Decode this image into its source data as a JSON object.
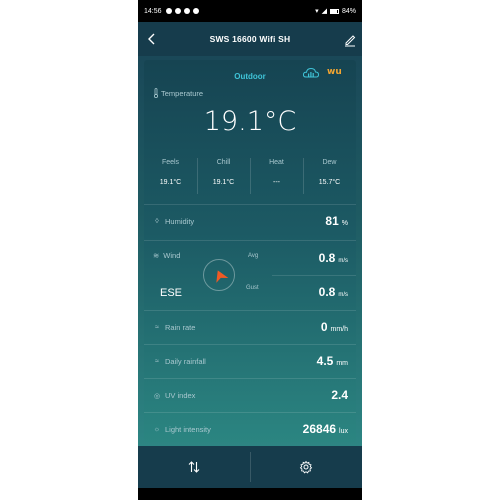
{
  "statusbar": {
    "time": "14:56",
    "battery": "84%"
  },
  "header": {
    "title": "SWS 16600 Wifi SH"
  },
  "outdoor": {
    "title": "Outdoor",
    "logo_text": "wu",
    "temperature_label": "Temperature",
    "temperature_value": "19.1°C",
    "feels_label": "Feels",
    "feels_value": "19.1°C",
    "chill_label": "Chill",
    "chill_value": "19.1°C",
    "heat_label": "Heat",
    "heat_value": "---",
    "dew_label": "Dew",
    "dew_value": "15.7°C"
  },
  "humidity": {
    "label": "Humidity",
    "value": "81",
    "unit": "%"
  },
  "wind": {
    "label": "Wind",
    "direction": "ESE",
    "avg_label": "Avg",
    "avg_value": "0.8",
    "gust_label": "Gust",
    "gust_value": "0.8",
    "unit": "m/s"
  },
  "rain_rate": {
    "label": "Rain rate",
    "value": "0",
    "unit": "mm/h"
  },
  "daily_rainfall": {
    "label": "Daily rainfall",
    "value": "4.5",
    "unit": "mm"
  },
  "uv_index": {
    "label": "UV index",
    "value": "2.4"
  },
  "light_intensity": {
    "label": "Light intensity",
    "value": "26846",
    "unit": "lux"
  },
  "colors": {
    "accent": "#3fc4d8",
    "wind_arrow": "#f05a24",
    "bar": "#163c4c"
  }
}
